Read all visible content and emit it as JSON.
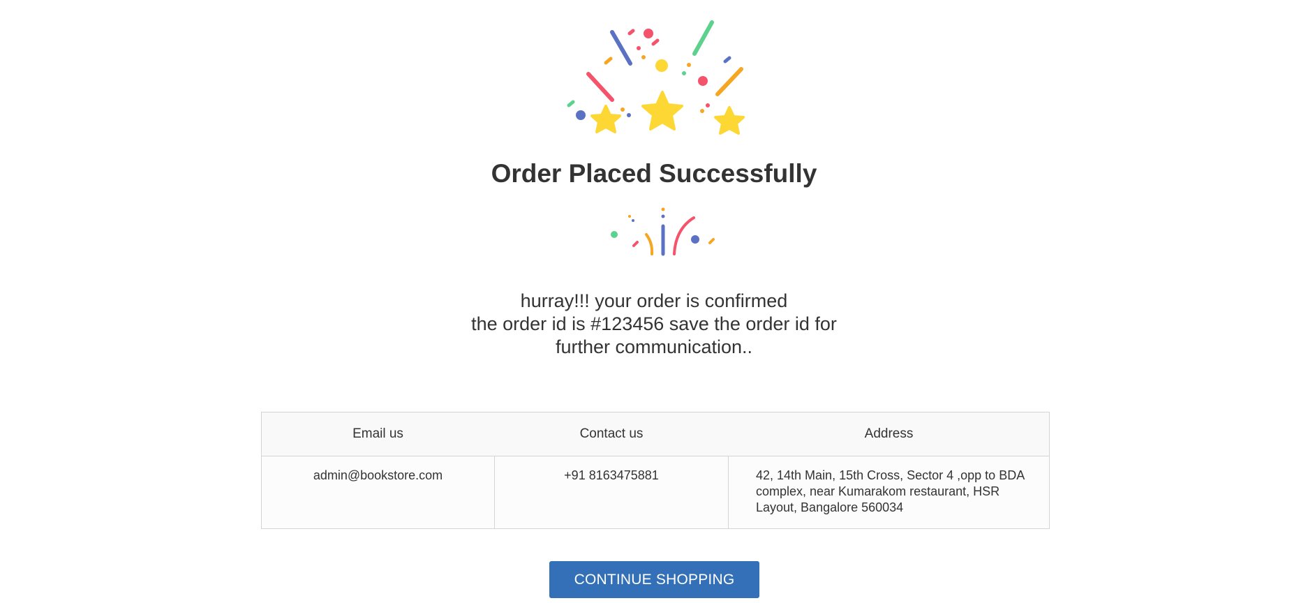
{
  "page": {
    "title": "Order Placed Successfully"
  },
  "message": {
    "line1": "hurray!!! your order is confirmed",
    "line2": "the order id is #123456 save the order id for",
    "line3": "further communication.."
  },
  "contact_table": {
    "headers": [
      "Email us",
      "Contact us",
      "Address"
    ],
    "email": "admin@bookstore.com",
    "phone": "+91 8163475881",
    "address": "42, 14th Main, 15th Cross, Sector 4 ,opp to BDA complex, near Kumarakom restaurant, HSR Layout, Bangalore 560034"
  },
  "actions": {
    "continue_label": "CONTINUE SHOPPING"
  },
  "icons": {
    "top_illustration": "celebration-stars-confetti-icon",
    "small_illustration": "party-popper-confetti-icon"
  },
  "colors": {
    "primary_button": "#3370b7",
    "confetti_red": "#f5536b",
    "confetti_blue": "#5b72c4",
    "confetti_green": "#5fd18f",
    "confetti_orange": "#f5a623",
    "star_yellow": "#fdd835"
  }
}
